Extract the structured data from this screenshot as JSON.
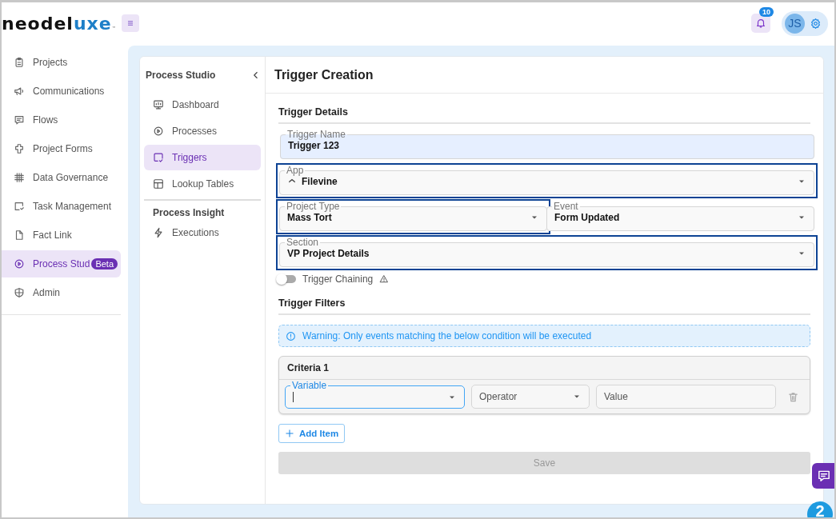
{
  "brand": {
    "name_dark": "neodel",
    "name_accent": "uxe",
    "trademark": "™"
  },
  "topbar": {
    "notification_count": "10",
    "user_initials": "JS"
  },
  "sidebar": {
    "items": [
      {
        "label": "Projects",
        "selected": false
      },
      {
        "label": "Communications",
        "selected": false
      },
      {
        "label": "Flows",
        "selected": false
      },
      {
        "label": "Project Forms",
        "selected": false
      },
      {
        "label": "Data Governance",
        "selected": false
      },
      {
        "label": "Task Management",
        "selected": false
      },
      {
        "label": "Fact Link",
        "selected": false
      },
      {
        "label": "Process Stud",
        "selected": true,
        "badge": "Beta"
      },
      {
        "label": "Admin",
        "selected": false
      }
    ]
  },
  "subnav": {
    "title": "Process Studio",
    "sections": [
      {
        "items": [
          {
            "label": "Dashboard",
            "selected": false
          },
          {
            "label": "Processes",
            "selected": false
          },
          {
            "label": "Triggers",
            "selected": true
          },
          {
            "label": "Lookup Tables",
            "selected": false
          }
        ]
      },
      {
        "heading": "Process Insight",
        "items": [
          {
            "label": "Executions",
            "selected": false
          }
        ]
      }
    ]
  },
  "form": {
    "title": "Trigger Creation",
    "details_heading": "Trigger Details",
    "rows": [
      [
        {
          "kind": "text",
          "label": "Trigger Name",
          "value": "Trigger 123",
          "highlighted": false
        }
      ],
      [
        {
          "kind": "app-select",
          "label": "App",
          "value": "Filevine",
          "highlighted": true
        }
      ],
      [
        {
          "kind": "select",
          "label": "Project Type",
          "value": "Mass Tort",
          "highlighted": true
        },
        {
          "kind": "select",
          "label": "Event",
          "value": "Form Updated",
          "highlighted": false
        }
      ],
      [
        {
          "kind": "select",
          "label": "Section",
          "value": "VP Project Details",
          "highlighted": true
        }
      ]
    ],
    "chaining": {
      "label": "Trigger Chaining",
      "on": false
    },
    "filters_heading": "Trigger Filters",
    "warning": "Warning: Only events matching the below condition will be executed",
    "criteria": [
      {
        "title": "Criteria 1",
        "fields": [
          {
            "kind": "select",
            "label": "Variable",
            "focused": true
          },
          {
            "kind": "select",
            "placeholder": "Operator",
            "focused": false
          },
          {
            "kind": "text",
            "placeholder": "Value",
            "focused": false
          }
        ]
      }
    ],
    "add_button": "Add Item",
    "save": {
      "label": "Save",
      "disabled": true
    }
  },
  "help_badge": "2"
}
